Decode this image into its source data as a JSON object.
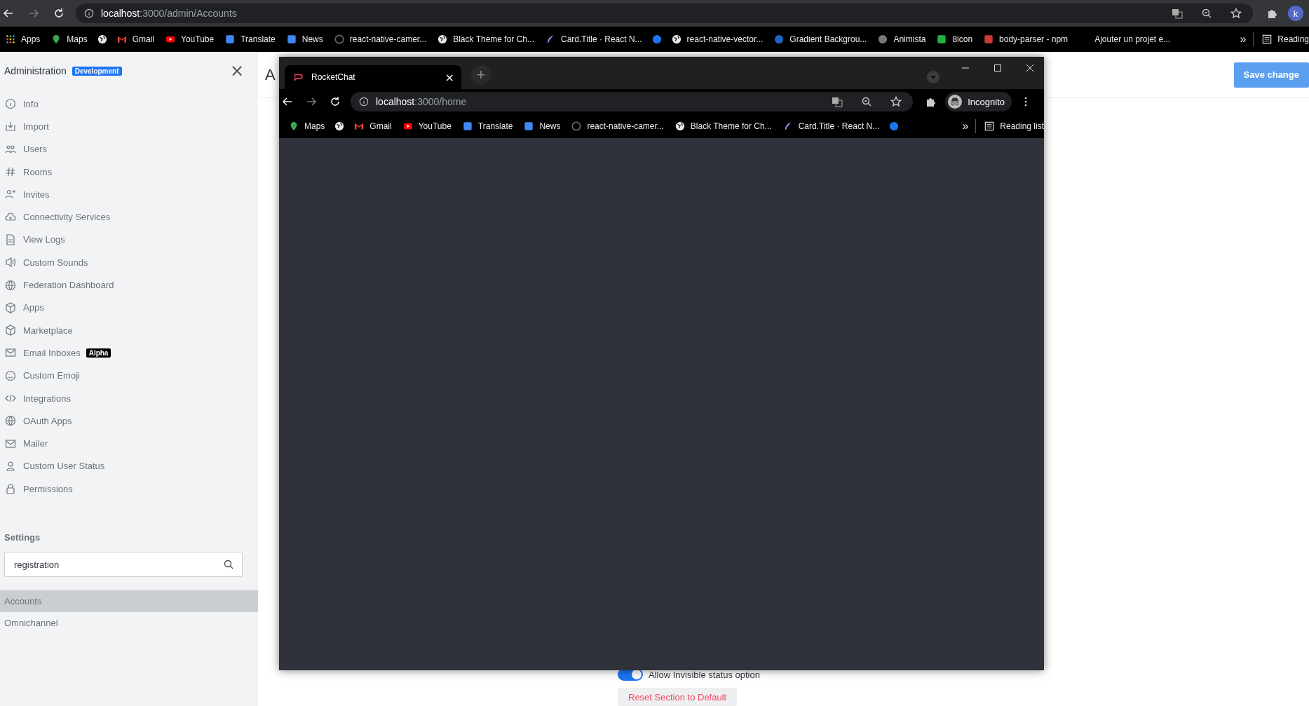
{
  "browser": {
    "url": "**localhost**:3000/admin/Accounts",
    "avatar": "k",
    "bookmarks": [
      {
        "kind": "link",
        "label": "Apps"
      },
      {
        "kind": "link",
        "label": "Maps"
      },
      {
        "kind": "icon"
      },
      {
        "kind": "link",
        "label": "Gmail"
      },
      {
        "kind": "link",
        "label": "YouTube"
      },
      {
        "kind": "link",
        "label": "Translate"
      },
      {
        "kind": "link",
        "label": "News"
      },
      {
        "kind": "link",
        "label": "react-native-camer..."
      },
      {
        "kind": "link",
        "label": "Black Theme for Ch..."
      },
      {
        "kind": "link",
        "label": "Card.Title · React N..."
      },
      {
        "kind": "icon"
      },
      {
        "kind": "link",
        "label": "react-native-vector..."
      },
      {
        "kind": "link",
        "label": "Gradient Backgrou..."
      },
      {
        "kind": "link",
        "label": "Animista"
      },
      {
        "kind": "link",
        "label": "8icon"
      },
      {
        "kind": "link",
        "label": "body-parser - npm"
      },
      {
        "kind": "text",
        "label": "Ajouter un projet e..."
      }
    ],
    "overflow": "»",
    "reading_list": "Reading"
  },
  "sidebar": {
    "title": "Administration",
    "badge": "Development",
    "close": "×",
    "items": [
      {
        "label": "Info"
      },
      {
        "label": "Import"
      },
      {
        "label": "Users"
      },
      {
        "label": "Rooms"
      },
      {
        "label": "Invites"
      },
      {
        "label": "Connectivity Services"
      },
      {
        "label": "View Logs"
      },
      {
        "label": "Custom Sounds"
      },
      {
        "label": "Federation Dashboard"
      },
      {
        "label": "Apps"
      },
      {
        "label": "Marketplace"
      },
      {
        "label": "Email Inboxes",
        "badge": "Alpha"
      },
      {
        "label": "Custom Emoji"
      },
      {
        "label": "Integrations"
      },
      {
        "label": "OAuth Apps"
      },
      {
        "label": "Mailer"
      },
      {
        "label": "Custom User Status"
      },
      {
        "label": "Permissions"
      }
    ],
    "settings_heading": "Settings",
    "search": {
      "value": "registration"
    },
    "groups": [
      {
        "label": "Accounts",
        "selected": true
      },
      {
        "label": "Omnichannel",
        "selected": false
      }
    ]
  },
  "page": {
    "title": "A",
    "save_button": {
      "label": "Save change",
      "disabled": true
    },
    "toggle": {
      "label": "Allow Invisible status option",
      "on": true
    },
    "reset_button": "Reset Section to Default"
  },
  "incognito_window": {
    "tab": {
      "title": "RocketChat",
      "close": "×"
    },
    "new_tab": "+",
    "url": "**localhost**:3000/home",
    "profile": "Incognito",
    "bookmarks": [
      {
        "kind": "link",
        "label": "Maps"
      },
      {
        "kind": "icon"
      },
      {
        "kind": "link",
        "label": "Gmail"
      },
      {
        "kind": "link",
        "label": "YouTube"
      },
      {
        "kind": "link",
        "label": "Translate"
      },
      {
        "kind": "link",
        "label": "News"
      },
      {
        "kind": "link",
        "label": "react-native-camer..."
      },
      {
        "kind": "link",
        "label": "Black Theme for Ch..."
      },
      {
        "kind": "link",
        "label": "Card.Title · React N..."
      },
      {
        "kind": "icon"
      }
    ],
    "overflow": "»",
    "reading_list": "Reading list"
  }
}
